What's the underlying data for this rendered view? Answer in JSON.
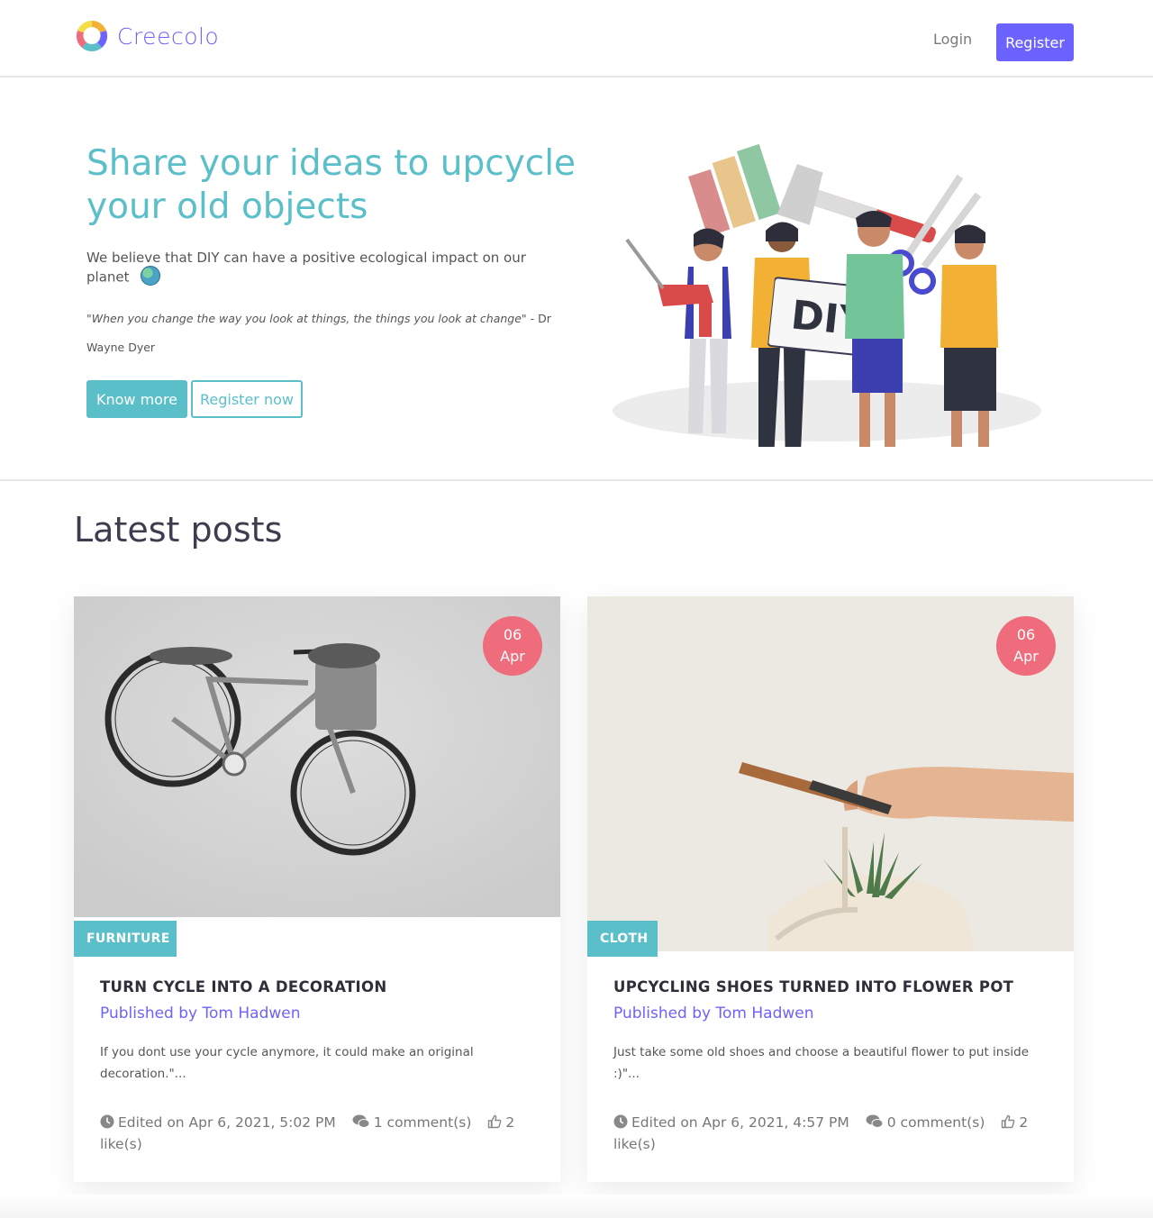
{
  "navbar": {
    "logo_text": "Creecolo",
    "login_label": "Login",
    "register_label": "Register",
    "brand_color": "#6c63ff"
  },
  "hero": {
    "title": "Share your ideas to upcycle your old objects",
    "description": "We believe that DIY can have a positive ecological impact on our planet",
    "description_icon": "globe-emoji",
    "quote": "\"When you change the way you look at things, the things you look at change\"",
    "quote_author": " - Dr Wayne Dyer",
    "know_more_label": "Know more",
    "register_now_label": "Register now",
    "illustration_text": "DIY",
    "accent_color": "#5bbfc9"
  },
  "latest": {
    "title": "Latest posts"
  },
  "posts": [
    {
      "day": "06",
      "month": "Apr",
      "category": "FURNITURE",
      "title": "TURN CYCLE INTO A DECORATION",
      "author": "Published by Tom Hadwen",
      "excerpt": "If you dont use your cycle anymore, it could make an original decoration.\"...",
      "edited": "Edited on Apr 6, 2021, 5:02 PM",
      "comments": "1 comment(s)",
      "likes": "2 like(s)"
    },
    {
      "day": "06",
      "month": "Apr",
      "category": "CLOTH",
      "title": "UPCYCLING SHOES TURNED INTO FLOWER POT",
      "author": "Published by Tom Hadwen",
      "excerpt": "Just take some old shoes and choose a beautiful flower to put inside :)\"...",
      "edited": "Edited on Apr 6, 2021, 4:57 PM",
      "comments": "0 comment(s)",
      "likes": "2 like(s)"
    }
  ],
  "colors": {
    "date_badge": "#ee6c7c",
    "category_tag": "#5bbfc9",
    "author_link": "#6c63ff"
  }
}
